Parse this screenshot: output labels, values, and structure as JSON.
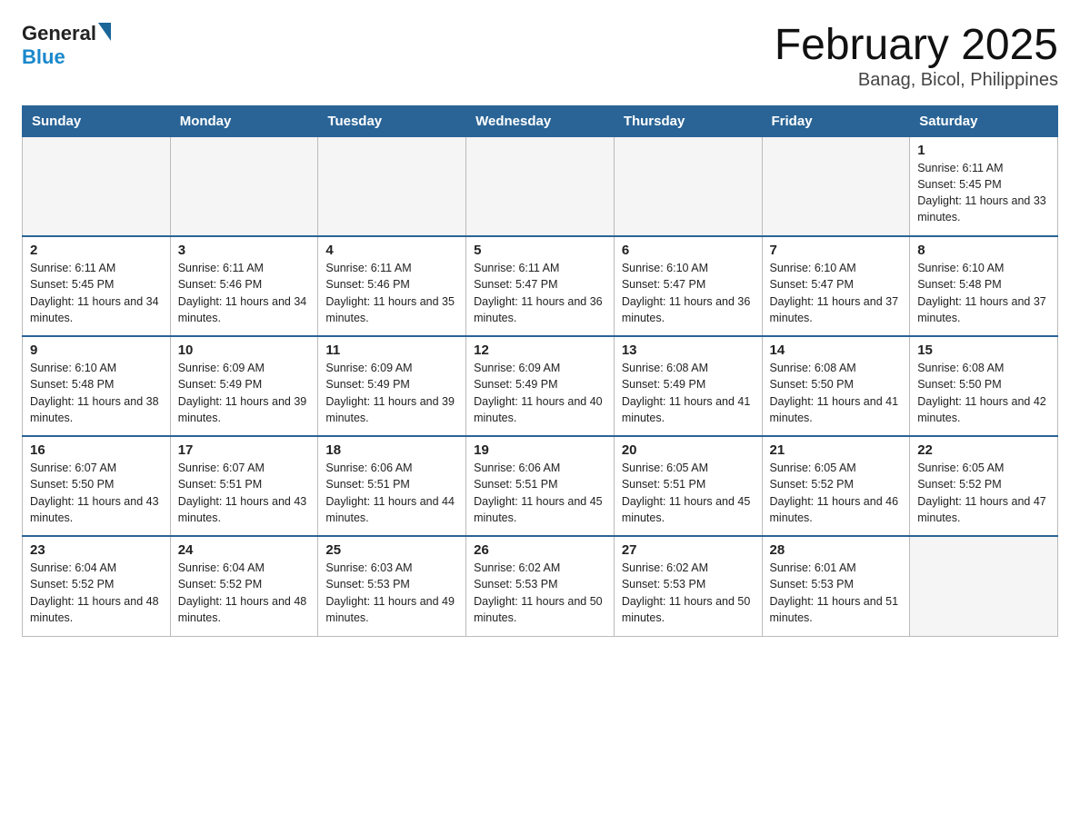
{
  "logo": {
    "general": "General",
    "blue": "Blue"
  },
  "title": "February 2025",
  "subtitle": "Banag, Bicol, Philippines",
  "days": [
    "Sunday",
    "Monday",
    "Tuesday",
    "Wednesday",
    "Thursday",
    "Friday",
    "Saturday"
  ],
  "weeks": [
    [
      {
        "day": "",
        "info": ""
      },
      {
        "day": "",
        "info": ""
      },
      {
        "day": "",
        "info": ""
      },
      {
        "day": "",
        "info": ""
      },
      {
        "day": "",
        "info": ""
      },
      {
        "day": "",
        "info": ""
      },
      {
        "day": "1",
        "info": "Sunrise: 6:11 AM\nSunset: 5:45 PM\nDaylight: 11 hours and 33 minutes."
      }
    ],
    [
      {
        "day": "2",
        "info": "Sunrise: 6:11 AM\nSunset: 5:45 PM\nDaylight: 11 hours and 34 minutes."
      },
      {
        "day": "3",
        "info": "Sunrise: 6:11 AM\nSunset: 5:46 PM\nDaylight: 11 hours and 34 minutes."
      },
      {
        "day": "4",
        "info": "Sunrise: 6:11 AM\nSunset: 5:46 PM\nDaylight: 11 hours and 35 minutes."
      },
      {
        "day": "5",
        "info": "Sunrise: 6:11 AM\nSunset: 5:47 PM\nDaylight: 11 hours and 36 minutes."
      },
      {
        "day": "6",
        "info": "Sunrise: 6:10 AM\nSunset: 5:47 PM\nDaylight: 11 hours and 36 minutes."
      },
      {
        "day": "7",
        "info": "Sunrise: 6:10 AM\nSunset: 5:47 PM\nDaylight: 11 hours and 37 minutes."
      },
      {
        "day": "8",
        "info": "Sunrise: 6:10 AM\nSunset: 5:48 PM\nDaylight: 11 hours and 37 minutes."
      }
    ],
    [
      {
        "day": "9",
        "info": "Sunrise: 6:10 AM\nSunset: 5:48 PM\nDaylight: 11 hours and 38 minutes."
      },
      {
        "day": "10",
        "info": "Sunrise: 6:09 AM\nSunset: 5:49 PM\nDaylight: 11 hours and 39 minutes."
      },
      {
        "day": "11",
        "info": "Sunrise: 6:09 AM\nSunset: 5:49 PM\nDaylight: 11 hours and 39 minutes."
      },
      {
        "day": "12",
        "info": "Sunrise: 6:09 AM\nSunset: 5:49 PM\nDaylight: 11 hours and 40 minutes."
      },
      {
        "day": "13",
        "info": "Sunrise: 6:08 AM\nSunset: 5:49 PM\nDaylight: 11 hours and 41 minutes."
      },
      {
        "day": "14",
        "info": "Sunrise: 6:08 AM\nSunset: 5:50 PM\nDaylight: 11 hours and 41 minutes."
      },
      {
        "day": "15",
        "info": "Sunrise: 6:08 AM\nSunset: 5:50 PM\nDaylight: 11 hours and 42 minutes."
      }
    ],
    [
      {
        "day": "16",
        "info": "Sunrise: 6:07 AM\nSunset: 5:50 PM\nDaylight: 11 hours and 43 minutes."
      },
      {
        "day": "17",
        "info": "Sunrise: 6:07 AM\nSunset: 5:51 PM\nDaylight: 11 hours and 43 minutes."
      },
      {
        "day": "18",
        "info": "Sunrise: 6:06 AM\nSunset: 5:51 PM\nDaylight: 11 hours and 44 minutes."
      },
      {
        "day": "19",
        "info": "Sunrise: 6:06 AM\nSunset: 5:51 PM\nDaylight: 11 hours and 45 minutes."
      },
      {
        "day": "20",
        "info": "Sunrise: 6:05 AM\nSunset: 5:51 PM\nDaylight: 11 hours and 45 minutes."
      },
      {
        "day": "21",
        "info": "Sunrise: 6:05 AM\nSunset: 5:52 PM\nDaylight: 11 hours and 46 minutes."
      },
      {
        "day": "22",
        "info": "Sunrise: 6:05 AM\nSunset: 5:52 PM\nDaylight: 11 hours and 47 minutes."
      }
    ],
    [
      {
        "day": "23",
        "info": "Sunrise: 6:04 AM\nSunset: 5:52 PM\nDaylight: 11 hours and 48 minutes."
      },
      {
        "day": "24",
        "info": "Sunrise: 6:04 AM\nSunset: 5:52 PM\nDaylight: 11 hours and 48 minutes."
      },
      {
        "day": "25",
        "info": "Sunrise: 6:03 AM\nSunset: 5:53 PM\nDaylight: 11 hours and 49 minutes."
      },
      {
        "day": "26",
        "info": "Sunrise: 6:02 AM\nSunset: 5:53 PM\nDaylight: 11 hours and 50 minutes."
      },
      {
        "day": "27",
        "info": "Sunrise: 6:02 AM\nSunset: 5:53 PM\nDaylight: 11 hours and 50 minutes."
      },
      {
        "day": "28",
        "info": "Sunrise: 6:01 AM\nSunset: 5:53 PM\nDaylight: 11 hours and 51 minutes."
      },
      {
        "day": "",
        "info": ""
      }
    ]
  ]
}
